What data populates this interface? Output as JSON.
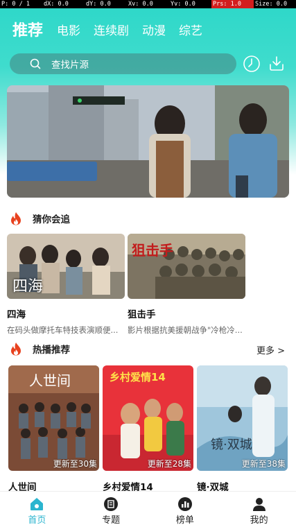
{
  "debug": {
    "p": "P: 0 / 1",
    "dx": "dX: 0.0",
    "dy": "dY: 0.0",
    "xv": "Xv: 0.0",
    "yv": "Yv: 0.0",
    "prs": "Prs: 1.0",
    "size": "Size: 0.0"
  },
  "top_tabs": [
    "推荐",
    "电影",
    "连续剧",
    "动漫",
    "综艺"
  ],
  "search": {
    "placeholder": "查找片源"
  },
  "header_icons": [
    "history-clock-icon",
    "download-icon"
  ],
  "sections": {
    "recommend": {
      "title": "猜你会追",
      "items": [
        {
          "title": "四海",
          "desc": "在码头做摩托车特技表演顺便...",
          "poster_text": "四海"
        },
        {
          "title": "狙击手",
          "desc": "影片根据抗美援朝战争\"冷枪冷...",
          "poster_text": "狙击手"
        }
      ]
    },
    "hot": {
      "title": "热播推荐",
      "more": "更多 >",
      "items": [
        {
          "title": "人世间",
          "badge": "更新至30集",
          "poster_text": "人世间"
        },
        {
          "title": "乡村爱情14",
          "badge": "更新至28集",
          "poster_text": "乡村爱情14"
        },
        {
          "title": "镜·双城",
          "badge": "更新至38集",
          "poster_text": "镜·双城"
        }
      ]
    }
  },
  "bottom_nav": [
    {
      "label": "首页",
      "icon": "home-icon",
      "active": true
    },
    {
      "label": "专题",
      "icon": "topic-icon",
      "active": false
    },
    {
      "label": "榜单",
      "icon": "chart-icon",
      "active": false
    },
    {
      "label": "我的",
      "icon": "user-icon",
      "active": false
    }
  ],
  "colors": {
    "accent": "#2bb5cf",
    "header": "#3fdccd",
    "fire": "#e8421f"
  }
}
